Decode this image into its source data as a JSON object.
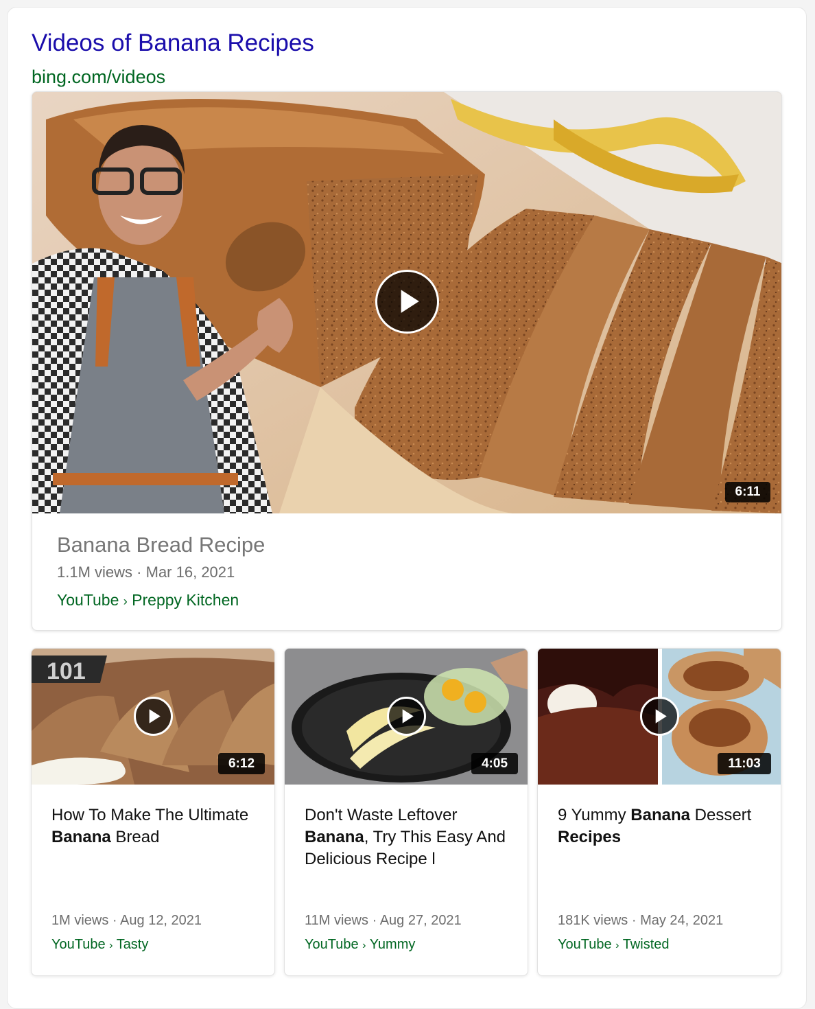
{
  "result": {
    "title": "Videos of Banana Recipes",
    "url": "bing.com/videos"
  },
  "main_video": {
    "duration": "6:11",
    "title": "Banana Bread Recipe",
    "views": "1.1M views",
    "date": "Mar 16, 2021",
    "platform": "YouTube",
    "separator": "›",
    "channel": "Preppy Kitchen"
  },
  "videos": [
    {
      "duration": "6:12",
      "badge": "101",
      "title_parts": [
        "How To Make The Ultimate ",
        "Banana",
        " Bread"
      ],
      "views": "1M views",
      "date": "Aug 12, 2021",
      "platform": "YouTube",
      "channel": "Tasty"
    },
    {
      "duration": "4:05",
      "title_parts": [
        "Don't Waste Leftover ",
        "Banana",
        ", Try This Easy And Delicious Recipe l"
      ],
      "views": "11M views",
      "date": "Aug 27, 2021",
      "platform": "YouTube",
      "channel": "Yummy"
    },
    {
      "duration": "11:03",
      "title_parts": [
        "9 Yummy ",
        "Banana",
        " Dessert ",
        "Recipes"
      ],
      "views": "181K views",
      "date": "May 24, 2021",
      "platform": "YouTube",
      "channel": "Twisted"
    }
  ],
  "meta_separator": "·",
  "colors": {
    "link": "#1a0dab",
    "url": "#006621",
    "meta": "#6d6d6d"
  }
}
